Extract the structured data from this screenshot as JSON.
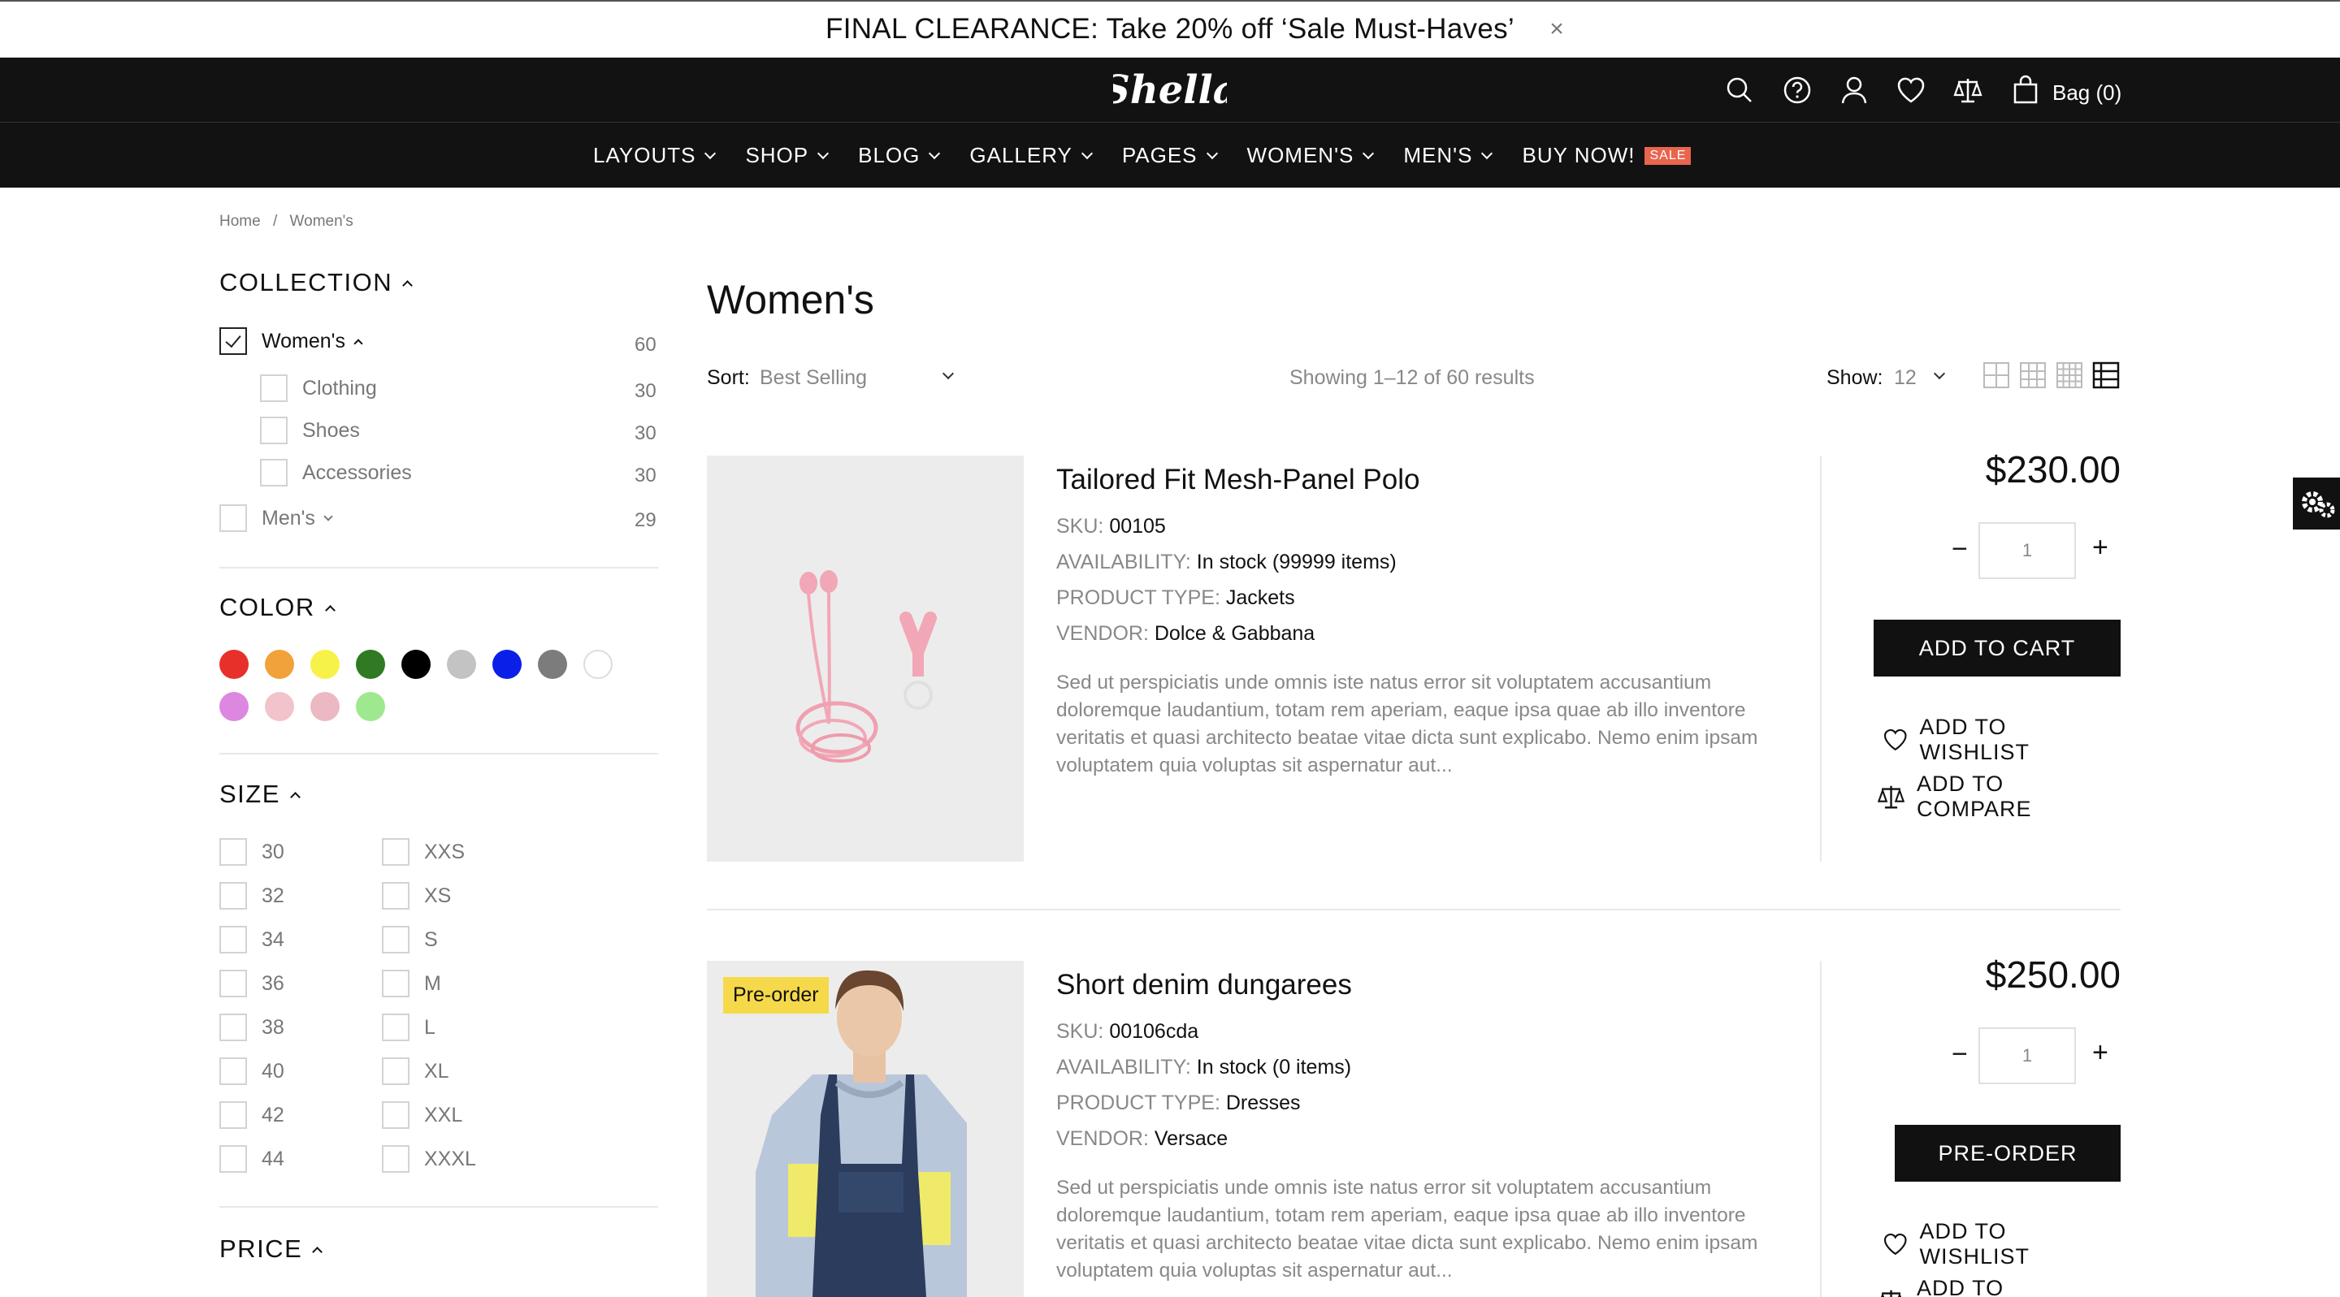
{
  "promo": {
    "text": "FINAL CLEARANCE: Take 20% off ‘Sale Must-Haves’",
    "close": "×"
  },
  "header": {
    "logo": "Shella",
    "bag_label": "Bag (0)"
  },
  "nav": [
    {
      "label": "LAYOUTS"
    },
    {
      "label": "SHOP"
    },
    {
      "label": "BLOG"
    },
    {
      "label": "GALLERY"
    },
    {
      "label": "PAGES"
    },
    {
      "label": "WOMEN'S"
    },
    {
      "label": "MEN'S"
    },
    {
      "label": "BUY NOW!",
      "badge": "SALE"
    }
  ],
  "breadcrumb": {
    "home": "Home",
    "sep": "/",
    "current": "Women's"
  },
  "collection": {
    "title": "COLLECTION",
    "items": [
      {
        "label": "Women's",
        "count": "60",
        "checked": true
      },
      {
        "label": "Clothing",
        "count": "30"
      },
      {
        "label": "Shoes",
        "count": "30"
      },
      {
        "label": "Accessories",
        "count": "30"
      },
      {
        "label": "Men's",
        "count": "29"
      }
    ]
  },
  "color": {
    "title": "COLOR",
    "swatches": [
      "#e8302a",
      "#f2a23a",
      "#f7f24a",
      "#2f7a22",
      "#000000",
      "#c3c3c3",
      "#0a1fe8",
      "#7c7c7c",
      "#ffffff",
      "#dd88e0",
      "#f2c3cb",
      "#ebb9c2",
      "#9ee890"
    ]
  },
  "size": {
    "title": "SIZE",
    "col1": [
      "30",
      "32",
      "34",
      "36",
      "38",
      "40",
      "42",
      "44"
    ],
    "col2": [
      "XXS",
      "XS",
      "S",
      "M",
      "L",
      "XL",
      "XXL",
      "XXXL"
    ]
  },
  "price": {
    "title": "PRICE"
  },
  "page_title": "Women's",
  "toolbar": {
    "sort_label": "Sort:",
    "sort_value": "Best Selling",
    "showing": "Showing 1–12 of 60 results",
    "show_label": "Show:",
    "show_value": "12"
  },
  "products": [
    {
      "name": "Tailored Fit Mesh-Panel Polo",
      "sku_label": "SKU:",
      "sku": "00105",
      "availability_label": "AVAILABILITY:",
      "availability": "In stock (99999 items)",
      "type_label": "PRODUCT TYPE:",
      "type": "Jackets",
      "vendor_label": "VENDOR:",
      "vendor": "Dolce & Gabbana",
      "description": "Sed ut perspiciatis unde omnis iste natus error sit voluptatem accusantium doloremque laudantium, totam rem aperiam, eaque ipsa quae ab illo inventore veritatis et quasi architecto beatae vitae dicta sunt explicabo. Nemo enim ipsam voluptatem quia voluptas sit aspernatur aut...",
      "price": "$230.00",
      "qty": "1",
      "button": "ADD TO CART",
      "wishlist": "ADD TO WISHLIST",
      "compare": "ADD TO COMPARE"
    },
    {
      "name": "Short denim dungarees",
      "badge": "Pre-order",
      "sku_label": "SKU:",
      "sku": "00106cda",
      "availability_label": "AVAILABILITY:",
      "availability": "In stock (0 items)",
      "type_label": "PRODUCT TYPE:",
      "type": "Dresses",
      "vendor_label": "VENDOR:",
      "vendor": "Versace",
      "description": "Sed ut perspiciatis unde omnis iste natus error sit voluptatem accusantium doloremque laudantium, totam rem aperiam, eaque ipsa quae ab illo inventore veritatis et quasi architecto beatae vitae dicta sunt explicabo. Nemo enim ipsam voluptatem quia voluptas sit aspernatur aut...",
      "price": "$250.00",
      "qty": "1",
      "button": "PRE-ORDER",
      "wishlist": "ADD TO WISHLIST",
      "compare": "ADD TO COMPARE"
    }
  ]
}
